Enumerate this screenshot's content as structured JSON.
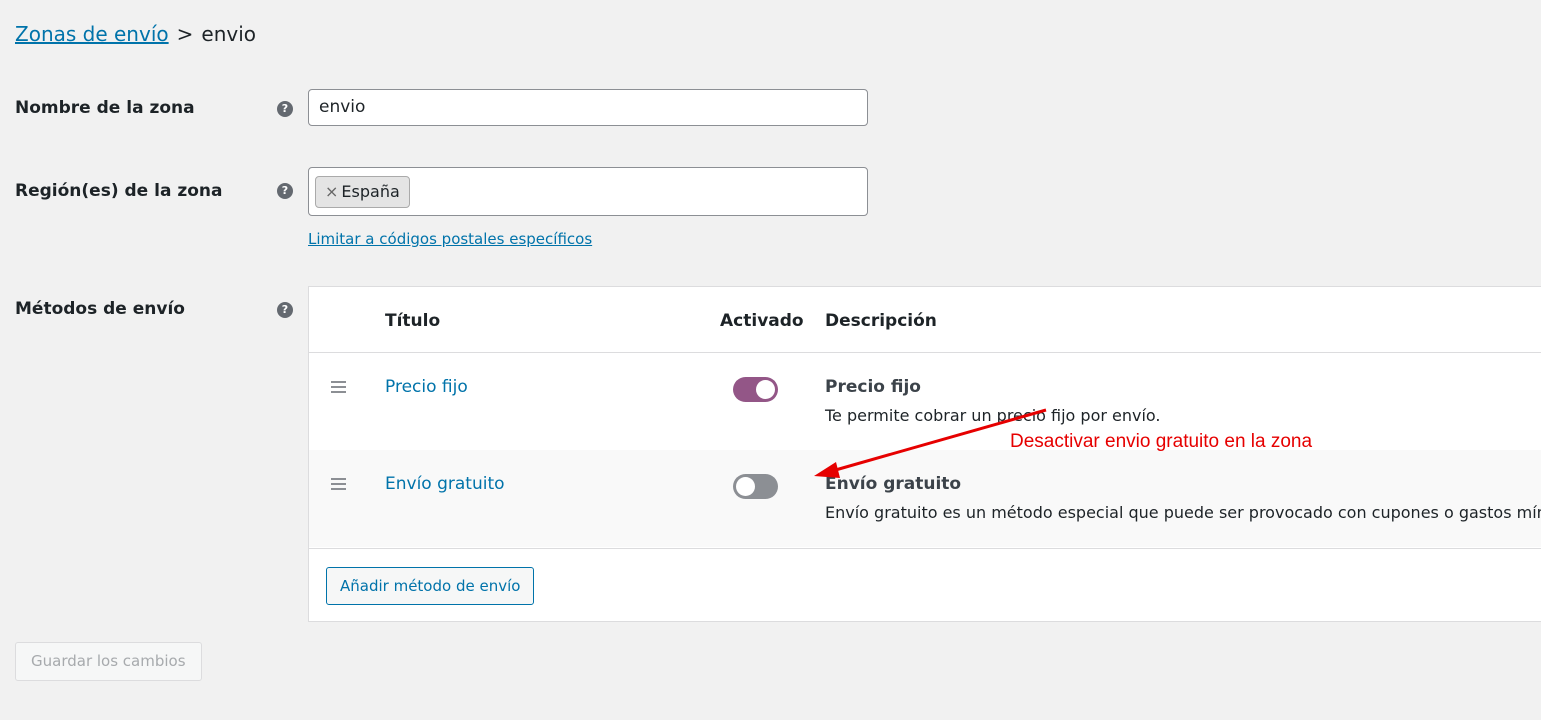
{
  "breadcrumb": {
    "parent": "Zonas de envío",
    "separator": ">",
    "current": "envio"
  },
  "zone_name": {
    "label": "Nombre de la zona",
    "value": "envio"
  },
  "zone_regions": {
    "label": "Región(es) de la zona",
    "chip_remove": "×",
    "chip": "España",
    "postcode_link": "Limitar a códigos postales específicos"
  },
  "methods": {
    "label": "Métodos de envío",
    "headers": {
      "title": "Título",
      "enabled": "Activado",
      "description": "Descripción"
    },
    "rows": [
      {
        "title": "Precio fijo",
        "enabled": true,
        "desc_title": "Precio fijo",
        "desc_text": "Te permite cobrar un precio fijo por envío."
      },
      {
        "title": "Envío gratuito",
        "enabled": false,
        "desc_title": "Envío gratuito",
        "desc_text": "Envío gratuito es un método especial que puede ser provocado con cupones o gastos mínimos."
      }
    ],
    "add_button": "Añadir método de envío"
  },
  "help_icon_glyph": "?",
  "save_button": "Guardar los cambios",
  "annotation": {
    "text": "Desactivar envio gratuito en la zona",
    "color": "#e60000"
  },
  "colors": {
    "link": "#0073aa",
    "toggle_on": "#935687",
    "toggle_off": "#8c8f94"
  }
}
